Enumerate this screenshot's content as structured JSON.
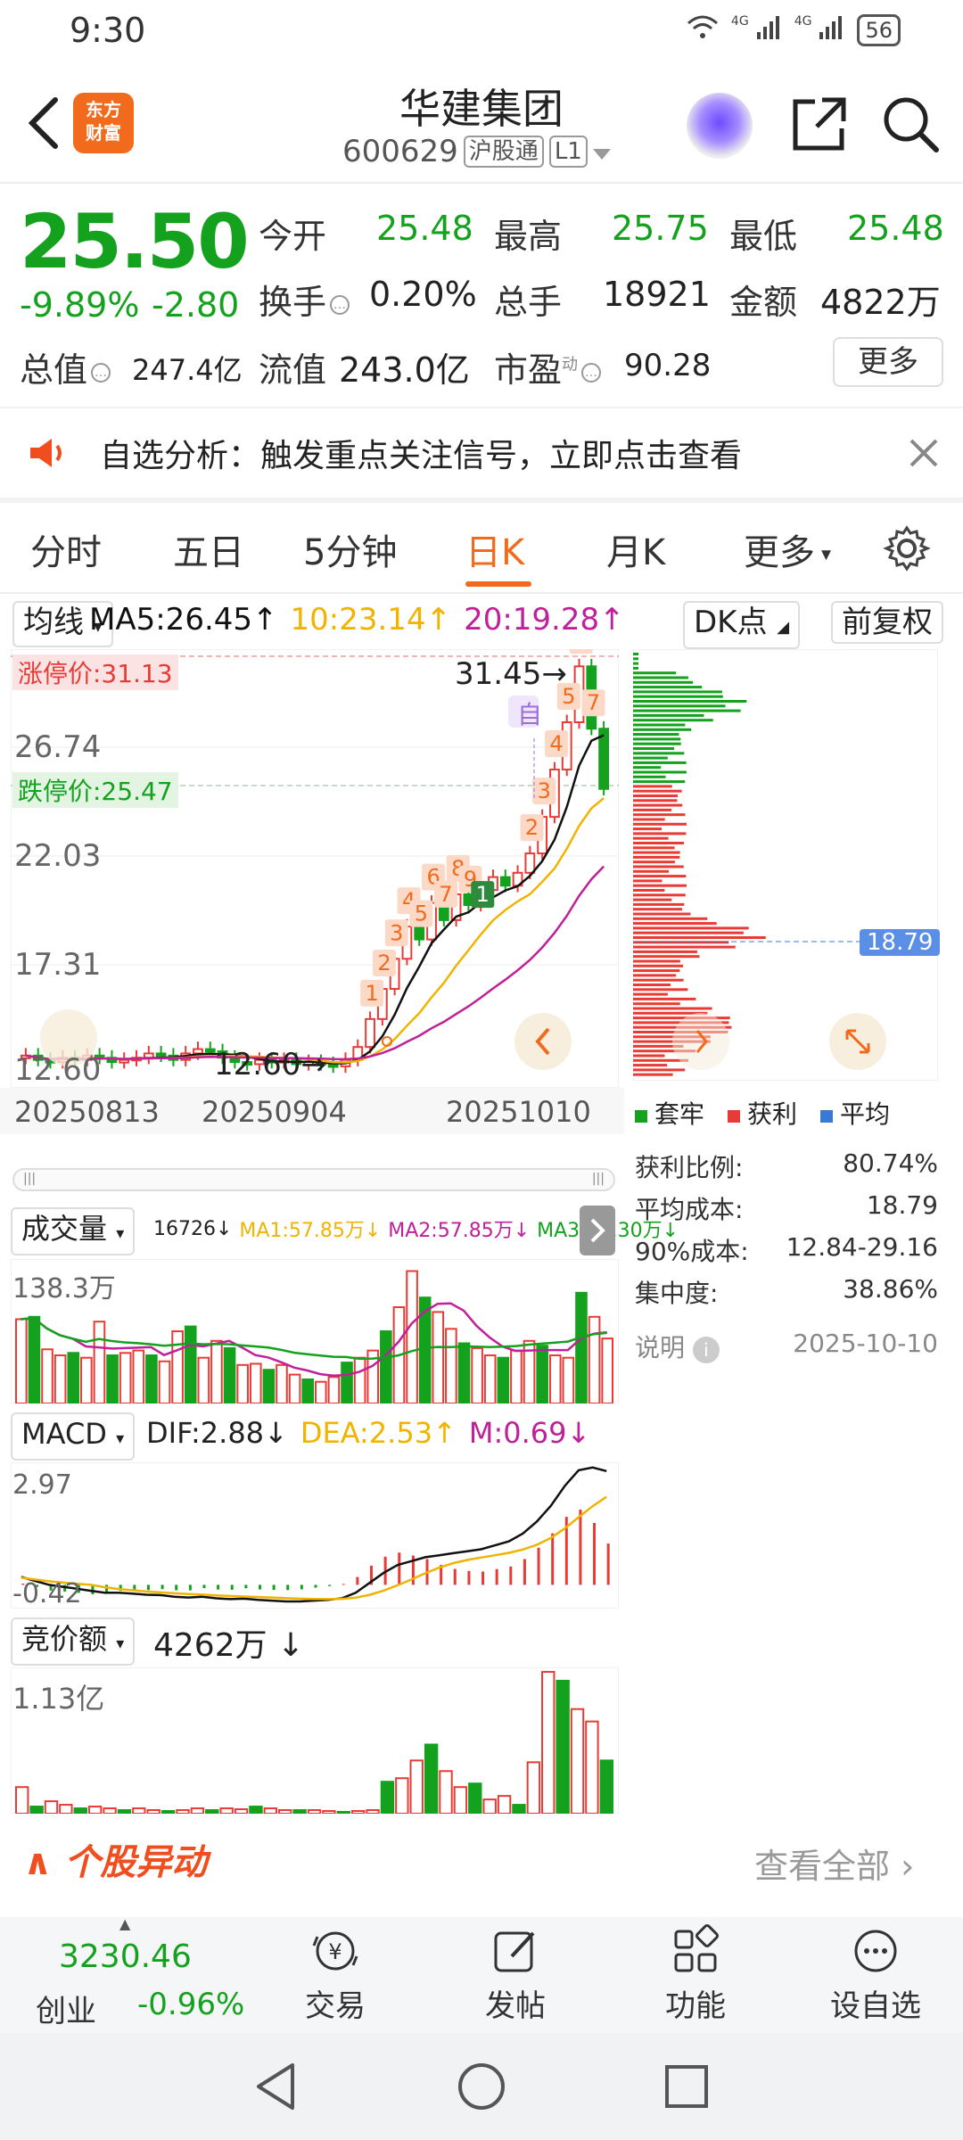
{
  "status": {
    "time": "9:30",
    "signal1": "4G",
    "signal2": "4G",
    "battery": "56"
  },
  "header": {
    "logo_line1": "东方",
    "logo_line2": "财富",
    "title": "华建集团",
    "code": "600629",
    "tag1": "沪股通",
    "tag2": "L1"
  },
  "quote": {
    "price": "25.50",
    "pct": "-9.89%",
    "change": "-2.80",
    "open_label": "今开",
    "open": "25.48",
    "high_label": "最高",
    "high": "25.75",
    "low_label": "最低",
    "low": "25.48",
    "turnover_label": "换手",
    "turnover": "0.20%",
    "volume_label": "总手",
    "volume": "18921",
    "amount_label": "金额",
    "amount": "4822万",
    "mktcap_label": "总值",
    "mktcap": "247.4亿",
    "float_label": "流值",
    "float": "243.0亿",
    "pe_label": "市盈",
    "pe_sup": "动",
    "pe": "90.28",
    "more": "更多"
  },
  "banner": {
    "text": "自选分析：触发重点关注信号，立即点击查看"
  },
  "tabs": [
    "分时",
    "五日",
    "5分钟",
    "日K",
    "月K",
    "更多"
  ],
  "active_tab": "日K",
  "kline": {
    "ma_select": "均线",
    "ma5": "MA5:26.45↑",
    "ma10": "10:23.14↑",
    "ma20": "20:19.28↑",
    "dk": "DK点",
    "fq": "前复权",
    "limit_up": "涨停价:31.13",
    "limit_down": "跌停价:25.47",
    "y_labels": [
      "26.74",
      "22.03",
      "17.31",
      "12.60"
    ],
    "high_mark": "31.45",
    "low_mark": "12.60",
    "self_mark": "自",
    "dates": [
      "20250813",
      "20250904",
      "20251010"
    ],
    "colors": {
      "up": "#e83b35",
      "down": "#14a21e",
      "ma5": "#111111",
      "ma10": "#f0b400",
      "ma20": "#c0209a"
    },
    "signals": [
      "1",
      "2",
      "3",
      "4",
      "5",
      "6",
      "7",
      "8",
      "9",
      "1",
      "2",
      "3",
      "4",
      "5",
      "6",
      "7"
    ]
  },
  "chips": {
    "legend": [
      "套牢",
      "获利",
      "平均"
    ],
    "avg_price": "18.79",
    "rows": [
      {
        "label": "获利比例:",
        "value": "80.74%"
      },
      {
        "label": "平均成本:",
        "value": "18.79"
      },
      {
        "label": "90%成本:",
        "value": "12.84-29.16"
      },
      {
        "label": "集中度:",
        "value": "38.86%"
      }
    ],
    "note": "说明",
    "date": "2025-10-10"
  },
  "volume": {
    "select": "成交量",
    "vol": "16726↓",
    "ma1": "MA1:57.85万↓",
    "ma2": "MA2:57.85万↓",
    "ma3": "MA3:64.30万↓",
    "max_label": "138.3万"
  },
  "macd": {
    "select": "MACD",
    "dif": "DIF:2.88↓",
    "dea": "DEA:2.53↑",
    "m": "M:0.69↓",
    "max_label": "2.97",
    "min_label": "-0.42"
  },
  "auction": {
    "select": "竞价额",
    "value": "4262万 ↓",
    "max_label": "1.13亿"
  },
  "movers": {
    "title": "个股异动",
    "view_all": "查看全部"
  },
  "bottom": {
    "index_value": "3230.46",
    "index_name": "创业",
    "index_pct": "-0.96%",
    "items": [
      "交易",
      "发帖",
      "功能",
      "设自选"
    ]
  }
}
